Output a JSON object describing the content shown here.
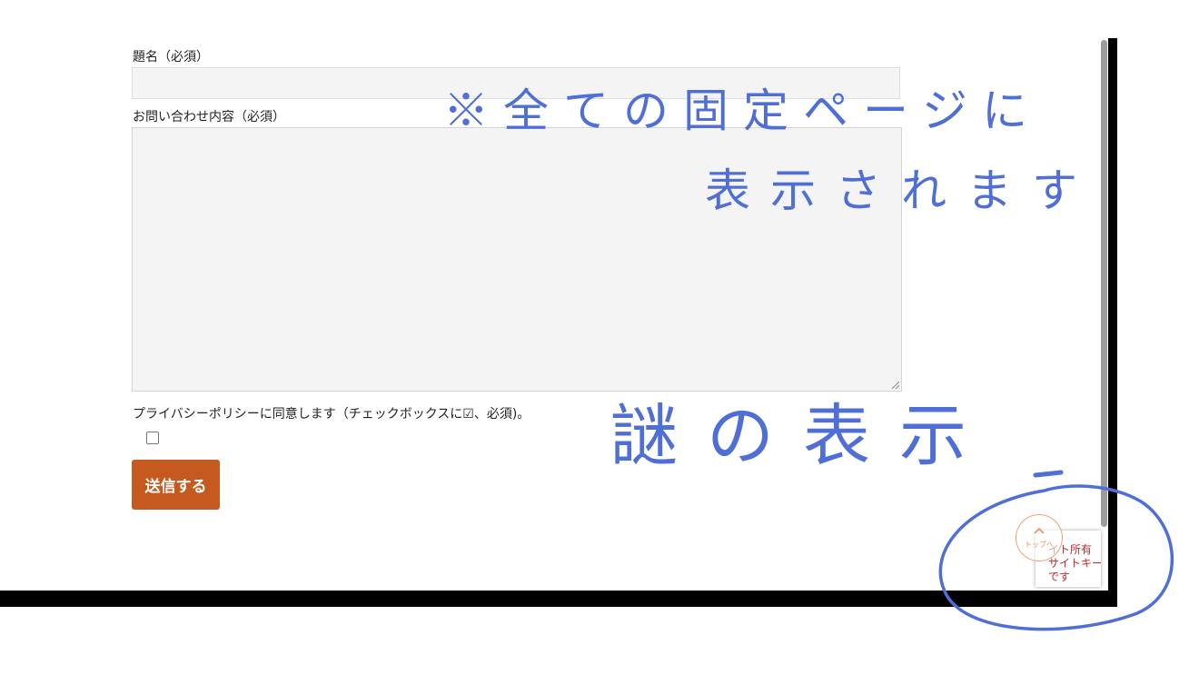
{
  "form": {
    "subject_label": "題名（必須）",
    "subject_value": "",
    "message_label": "お問い合わせ内容（必須）",
    "message_value": "",
    "privacy_label": "プライバシーポリシーに同意します（チェックボックスに☑、必須)。",
    "privacy_checked": false,
    "submit_label": "送信する"
  },
  "annotations": {
    "note_line1": "※全ての固定ページに",
    "note_line2": "表示されます",
    "mystery_label": "謎の表示"
  },
  "recaptcha_badge": {
    "line1": "イト所有",
    "line2": "サイトキー",
    "line3": "です"
  },
  "back_to_top": {
    "label": "トップへ",
    "icon": "chevron-up-icon"
  },
  "colors": {
    "accent": "#c65a1e",
    "annotation": "#4f6fd6",
    "error_text": "#c12a2a",
    "back_to_top": "#e8925f"
  }
}
